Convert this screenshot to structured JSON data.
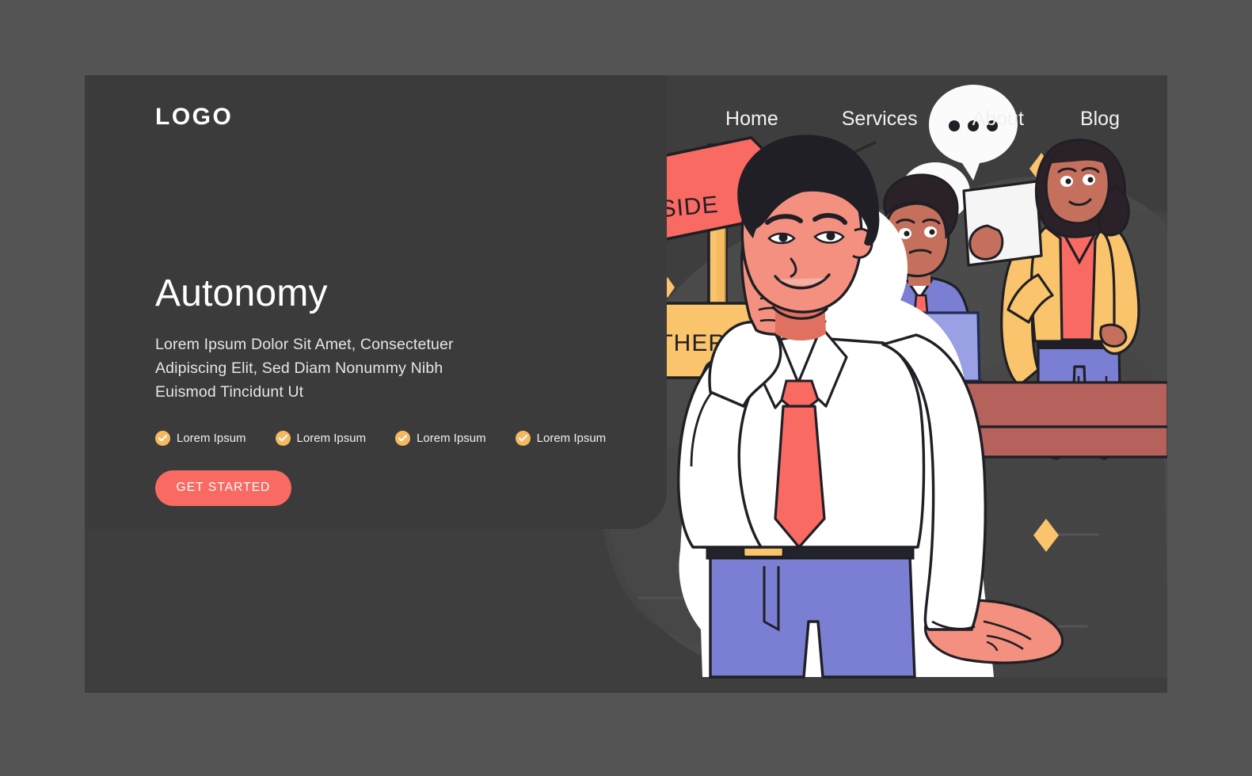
{
  "theme": {
    "page_bg": "#545454",
    "card_bg": "#3e3e3e",
    "panel_bg": "#3b3b3b",
    "accent_red": "#f96a62",
    "accent_yellow": "#f9c46b",
    "text_primary": "#ffffff",
    "text_secondary": "#e6e6e6",
    "blob_light": "#4a4a4a",
    "blob_dark": "#414141",
    "skin": "#f4907f",
    "shirt_white": "#ffffff",
    "pants_blue": "#7b7fd4",
    "desk_red": "#b5625c",
    "hair_black": "#1f1f25",
    "outline": "#1f1f25"
  },
  "header": {
    "logo": "LOGO",
    "nav": [
      {
        "label": "Home"
      },
      {
        "label": "Services"
      },
      {
        "label": "About"
      },
      {
        "label": "Blog"
      }
    ]
  },
  "hero": {
    "title": "Autonomy",
    "subtitle": "Lorem Ipsum Dolor Sit Amet, Consectetuer Adipiscing Elit, Sed Diam Nonummy Nibh Euismod Tincidunt Ut",
    "features": [
      {
        "label": "Lorem Ipsum"
      },
      {
        "label": "Lorem Ipsum"
      },
      {
        "label": "Lorem Ipsum"
      },
      {
        "label": "Lorem Ipsum"
      }
    ],
    "cta_label": "GET STARTED"
  },
  "illustration": {
    "alt": "Businessman pointing upward in front of two-way signpost while two colleagues talk behind a desk",
    "signs": [
      {
        "text": "ONE SIDE",
        "color": "#f96a62",
        "direction": "right"
      },
      {
        "text": "OTHER SIDE",
        "color": "#f9c46b",
        "direction": "left"
      }
    ],
    "speech_bubble_dots": "•••"
  }
}
